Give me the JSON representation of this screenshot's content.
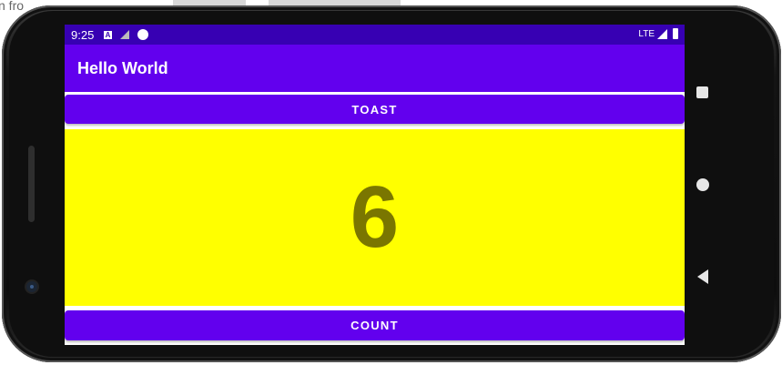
{
  "background": {
    "partial_text": "n fro"
  },
  "status_bar": {
    "time": "9:25",
    "left_icons": [
      "a-notification-icon",
      "no-signal-icon",
      "r-notification-icon"
    ],
    "network_label": "LTE",
    "right_icons": [
      "cell-signal-icon",
      "battery-icon"
    ],
    "color": "#3700b3"
  },
  "app_bar": {
    "title": "Hello World",
    "color": "#6200ee"
  },
  "toast_button": {
    "label": "TOAST"
  },
  "counter": {
    "value": "6",
    "background": "#ffff00",
    "text_color": "#7a7600"
  },
  "count_button": {
    "label": "COUNT"
  },
  "device_nav": [
    "overview-square-icon",
    "home-circle-icon",
    "back-triangle-icon"
  ]
}
